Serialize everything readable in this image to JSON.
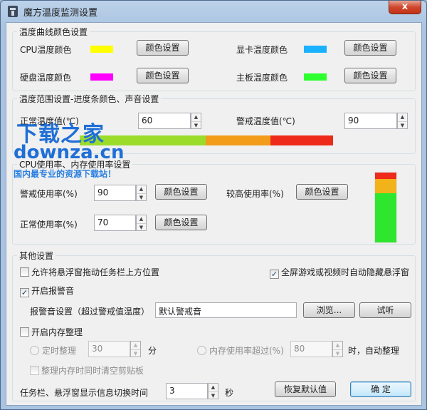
{
  "window": {
    "title": "魔方温度监测设置",
    "close_glyph": "x"
  },
  "colors": {
    "cpu": "#ffff00",
    "gpu": "#1ab2ff",
    "disk": "#ff00ff",
    "board": "#2eff2e",
    "bar_green": "#9bdc2b",
    "bar_orange": "#f29c1a",
    "bar_red": "#ee2a1a"
  },
  "curve_group": {
    "legend": "温度曲线颜色设置",
    "cpu_label": "CPU温度颜色",
    "gpu_label": "显卡温度颜色",
    "disk_label": "硬盘温度颜色",
    "board_label": "主板温度颜色",
    "color_button": "颜色设置"
  },
  "range_group": {
    "legend": "温度范围设置-进度条颜色、声音设置",
    "normal_label": "正常温度值(℃)",
    "normal_value": "60",
    "warn_label": "警戒温度值(℃)",
    "warn_value": "90"
  },
  "usage_group": {
    "legend": "CPU使用率、内存使用率设置",
    "warn_label": "警戒使用率(%)",
    "warn_value": "90",
    "high_label": "较高使用率(%)",
    "normal_label": "正常使用率(%)",
    "normal_value": "70",
    "color_button": "颜色设置"
  },
  "other_group": {
    "legend": "其他设置",
    "allow_drag_label": "允许将悬浮窗拖动任务栏上方位置",
    "fullscreen_hide_label": "全屏游戏或视频时自动隐藏悬浮窗",
    "alarm_label": "开启报警音",
    "alarm_setting_label": "报警音设置（超过警戒值温度）",
    "alarm_sound_value": "默认警戒音",
    "browse_button": "浏览...",
    "test_button": "试听",
    "mem_clean_label": "开启内存整理",
    "timed_clean_label": "定时整理",
    "timed_value": "30",
    "minutes_unit": "分",
    "mem_over_label": "内存使用率超过(%)",
    "mem_over_value": "80",
    "auto_clean_suffix": "时，自动整理",
    "clear_clipboard_label": "整理内存时同时清空剪贴板",
    "switch_label": "任务栏、悬浮窗显示信息切换时间",
    "switch_value": "3",
    "seconds_unit": "秒",
    "restore_button": "恢复默认值",
    "ok_button": "确  定"
  },
  "checkmark": "✓",
  "spin_up": "▲",
  "spin_down": "▼",
  "watermark": {
    "logo": "下载之家",
    "domain": "downza.cn",
    "slogan": "国内最专业的资源下载站！"
  }
}
